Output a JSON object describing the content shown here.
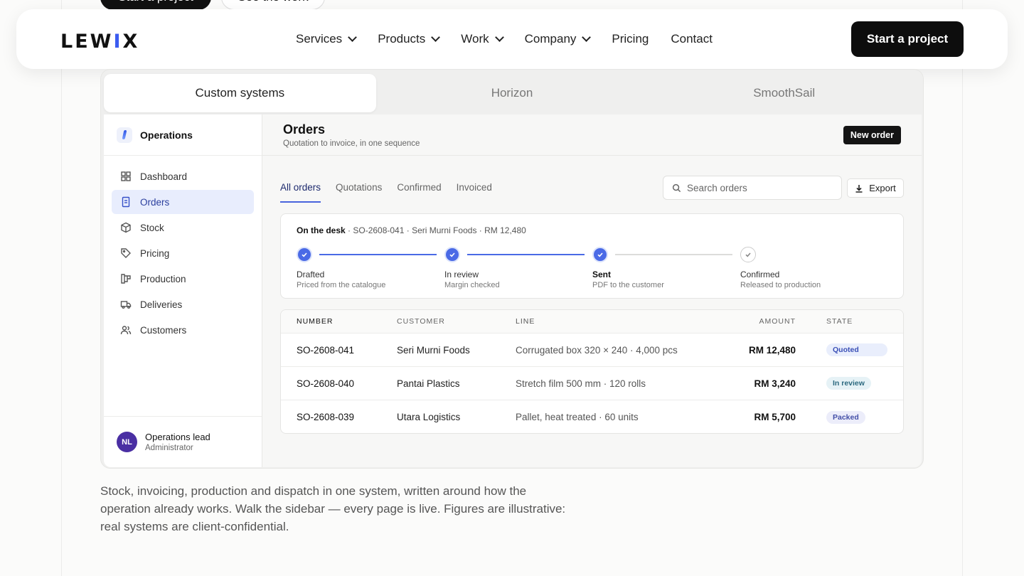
{
  "hero": {
    "primary_label": "Start a project",
    "secondary_label": "See the work"
  },
  "nav": {
    "logo": {
      "left": "LEW",
      "accent": "I",
      "right": "X"
    },
    "items": [
      {
        "label": "Services",
        "has_dropdown": true
      },
      {
        "label": "Products",
        "has_dropdown": true
      },
      {
        "label": "Work",
        "has_dropdown": true
      },
      {
        "label": "Company",
        "has_dropdown": true
      },
      {
        "label": "Pricing",
        "has_dropdown": false
      },
      {
        "label": "Contact",
        "has_dropdown": false
      }
    ],
    "cta_label": "Start a project"
  },
  "showcase_tabs": [
    "Custom systems",
    "Horizon",
    "SmoothSail"
  ],
  "app": {
    "sidebar": {
      "title": "Operations",
      "items": [
        {
          "label": "Dashboard",
          "icon": "grid-icon"
        },
        {
          "label": "Orders",
          "icon": "document-icon",
          "active": true
        },
        {
          "label": "Stock",
          "icon": "box-icon"
        },
        {
          "label": "Pricing",
          "icon": "tag-icon"
        },
        {
          "label": "Production",
          "icon": "factory-icon"
        },
        {
          "label": "Deliveries",
          "icon": "truck-icon"
        },
        {
          "label": "Customers",
          "icon": "users-icon"
        }
      ],
      "user": {
        "initials": "NL",
        "name": "Operations lead",
        "role": "Administrator"
      }
    },
    "header": {
      "title": "Orders",
      "subtitle": "Quotation to invoice, in one sequence",
      "new_order_label": "New order"
    },
    "filters": [
      "All orders",
      "Quotations",
      "Confirmed",
      "Invoiced"
    ],
    "search_placeholder": "Search orders",
    "export_label": "Export",
    "progress": {
      "label": "On the desk",
      "order": "SO-2608-041",
      "customer": "Seri Murni Foods",
      "amount": "RM 12,480",
      "steps": [
        {
          "title": "Drafted",
          "sub": "Priced from the catalogue",
          "status": "done"
        },
        {
          "title": "In review",
          "sub": "Margin checked",
          "status": "done"
        },
        {
          "title": "Sent",
          "sub": "PDF to the customer",
          "status": "current"
        },
        {
          "title": "Confirmed",
          "sub": "Released to production",
          "status": "pending"
        }
      ]
    },
    "table": {
      "headers": [
        "NUMBER",
        "CUSTOMER",
        "LINE",
        "AMOUNT",
        "STATE"
      ],
      "rows": [
        {
          "number": "SO-2608-041",
          "customer": "Seri Murni Foods",
          "line": "Corrugated box 320 × 240 · 4,000 pcs",
          "amount": "RM 12,480",
          "state": "Quoted"
        },
        {
          "number": "SO-2608-040",
          "customer": "Pantai Plastics",
          "line": "Stretch film 500 mm · 120 rolls",
          "amount": "RM 3,240",
          "state": "In review"
        },
        {
          "number": "SO-2608-039",
          "customer": "Utara Logistics",
          "line": "Pallet, heat treated · 60 units",
          "amount": "RM 5,700",
          "state": "Packed"
        }
      ]
    }
  },
  "caption": "Stock, invoicing, production and dispatch in one system, written around how the operation already works. Walk the sidebar — every page is live. Figures are illustrative: real systems are client-confidential.",
  "colors": {
    "accent": "#4a6ae6",
    "dark": "#0d0d0d",
    "avatar": "#4a2fa3"
  }
}
